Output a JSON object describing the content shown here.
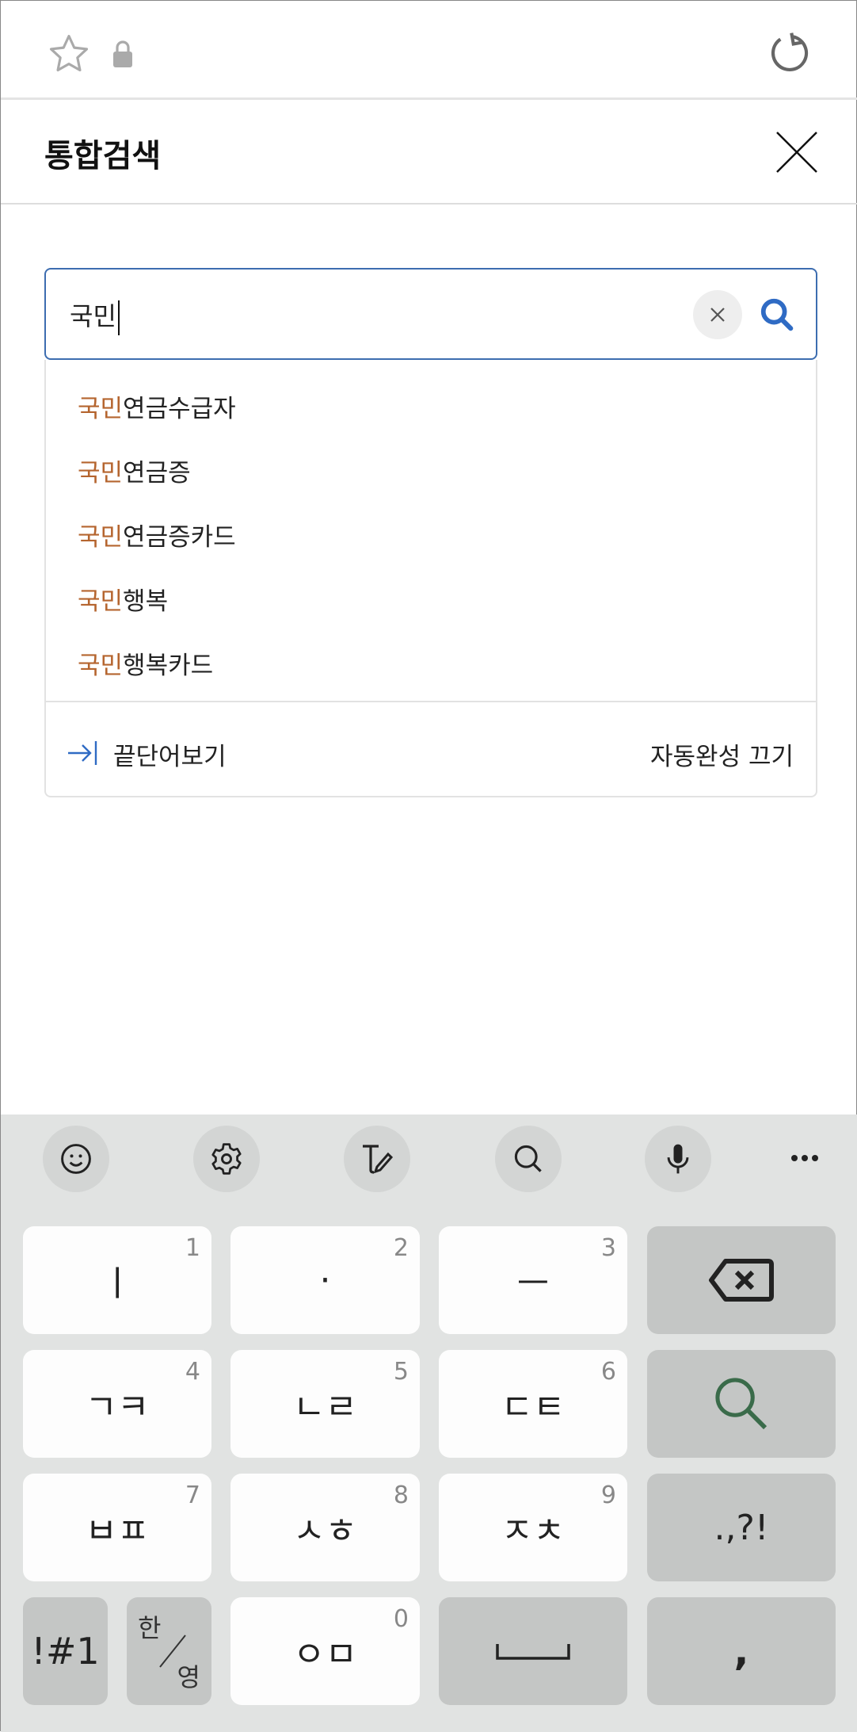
{
  "browser": {
    "icons": [
      "star-icon",
      "lock-icon",
      "refresh-icon"
    ]
  },
  "header": {
    "title": "통합검색"
  },
  "search": {
    "value": "국민"
  },
  "suggestions": [
    {
      "highlight": "국민",
      "rest": "연금수급자"
    },
    {
      "highlight": "국민",
      "rest": "연금증"
    },
    {
      "highlight": "국민",
      "rest": "연금증카드"
    },
    {
      "highlight": "국민",
      "rest": "행복"
    },
    {
      "highlight": "국민",
      "rest": "행복카드"
    }
  ],
  "footer": {
    "end_word": "끝단어보기",
    "autocomplete_off": "자동완성 끄기"
  },
  "keyboard": {
    "toolbar": [
      "emoji-icon",
      "settings-icon",
      "handwriting-icon",
      "search-icon",
      "microphone-icon",
      "more-icon"
    ],
    "rows": [
      [
        {
          "label": "ㅣ",
          "num": "1"
        },
        {
          "label": "·",
          "num": "2"
        },
        {
          "label": "ㅡ",
          "num": "3"
        }
      ],
      [
        {
          "label": "ㄱㅋ",
          "num": "4"
        },
        {
          "label": "ㄴㄹ",
          "num": "5"
        },
        {
          "label": "ㄷㅌ",
          "num": "6"
        }
      ],
      [
        {
          "label": "ㅂㅍ",
          "num": "7"
        },
        {
          "label": "ㅅㅎ",
          "num": "8"
        },
        {
          "label": "ㅈㅊ",
          "num": "9"
        }
      ]
    ],
    "punct": ".,?!",
    "symbols": "!#1",
    "lang_top": "한",
    "lang_bottom": "영",
    "zero_key": {
      "label": "ㅇㅁ",
      "num": "0"
    },
    "comma": ",",
    "search_color": "#3a6b4a"
  }
}
